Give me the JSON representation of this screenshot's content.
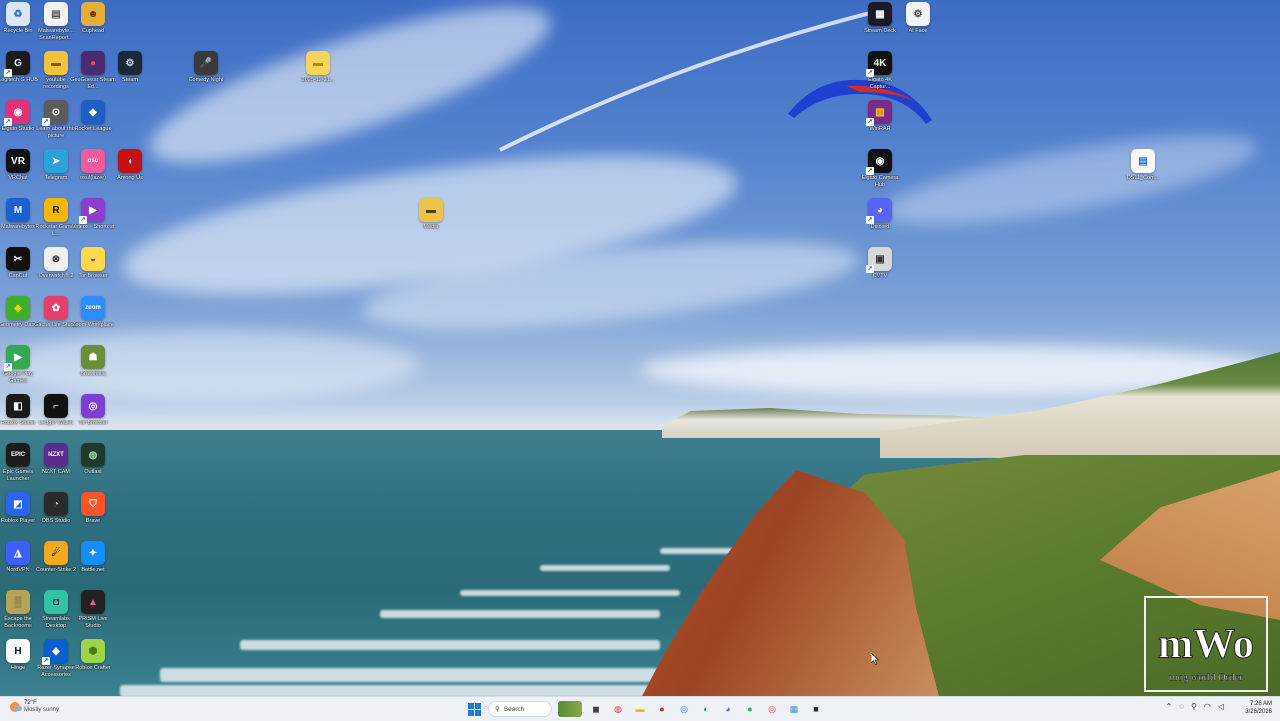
{
  "desktop": {
    "icons": [
      {
        "id": "recycle-bin",
        "label": "Recycle Bin",
        "color": "#d9e6f5",
        "glyph": "♻",
        "gcolor": "#2a6fd1"
      },
      {
        "id": "malwarebytes-doc",
        "label": "Malwarebyte... ScanReport...",
        "color": "#f2f2f2",
        "glyph": "▤",
        "gcolor": "#555"
      },
      {
        "id": "cuphead",
        "label": "Cuphead",
        "color": "#e0b03a",
        "glyph": "☻",
        "gcolor": "#6a2b12"
      },
      {
        "id": "logitech",
        "label": "Logitech G HUB",
        "color": "#1b1b1b",
        "glyph": "G",
        "gcolor": "#fff"
      },
      {
        "id": "youtube-recordings",
        "label": "youtube recordings",
        "color": "#f1c33b",
        "glyph": "▬",
        "gcolor": "#8a5b00"
      },
      {
        "id": "geoguessr",
        "label": "GeoGuessr Steam Ed...",
        "color": "#4a2b6e",
        "glyph": "●",
        "gcolor": "#f24a4a"
      },
      {
        "id": "steam",
        "label": "Steam",
        "color": "#1b2838",
        "glyph": "⚙",
        "gcolor": "#c6d4df"
      },
      {
        "id": "elgato-studio",
        "label": "Elgato Studio",
        "color": "#e0327a",
        "glyph": "◉",
        "gcolor": "#fff"
      },
      {
        "id": "learn-photo",
        "label": "Learn about this picture",
        "color": "#5c5c5c",
        "glyph": "⊙",
        "gcolor": "#fff"
      },
      {
        "id": "rocket-league",
        "label": "Rocket League",
        "color": "#1e5ec5",
        "glyph": "◆",
        "gcolor": "#fff"
      },
      {
        "id": "vrchat",
        "label": "VRChat",
        "color": "#111",
        "glyph": "VR",
        "gcolor": "#fff"
      },
      {
        "id": "telegram",
        "label": "Telegram",
        "color": "#2aa3dd",
        "glyph": "➤",
        "gcolor": "#fff"
      },
      {
        "id": "osu",
        "label": "osu!(lazer)",
        "color": "#f05ba0",
        "glyph": "osu",
        "gcolor": "#fff"
      },
      {
        "id": "among-us",
        "label": "Among Us",
        "color": "#c51111",
        "glyph": "◖",
        "gcolor": "#9ff"
      },
      {
        "id": "malwarebytes",
        "label": "Malwarebytes",
        "color": "#1b5fd1",
        "glyph": "M",
        "gcolor": "#fff"
      },
      {
        "id": "rockstar",
        "label": "Rockstar Games L...",
        "color": "#f5b800",
        "glyph": "R",
        "gcolor": "#111"
      },
      {
        "id": "videos-shortcut",
        "label": "Videos - Shortcut",
        "color": "#8a3fd1",
        "glyph": "▶",
        "gcolor": "#fff"
      },
      {
        "id": "capcut",
        "label": "CapCut",
        "color": "#111",
        "glyph": "✂",
        "gcolor": "#fff"
      },
      {
        "id": "overwatch",
        "label": "Overwatch® 2",
        "color": "#eee",
        "glyph": "⊗",
        "gcolor": "#333"
      },
      {
        "id": "tor-browser-1",
        "label": "Tor Browser",
        "color": "#ffd84d",
        "glyph": "◒",
        "gcolor": "#7d3fa0"
      },
      {
        "id": "geometry-dash",
        "label": "Geometry Dash",
        "color": "#3fae2a",
        "glyph": "◈",
        "gcolor": "#ffd000"
      },
      {
        "id": "gacha-life",
        "label": "Gacha Life Studio",
        "color": "#e5406a",
        "glyph": "✿",
        "gcolor": "#fff"
      },
      {
        "id": "zoom",
        "label": "Zoom Workplace",
        "color": "#2d8cff",
        "glyph": "zoom",
        "gcolor": "#fff"
      },
      {
        "id": "google-play-games",
        "label": "Google Play Games",
        "color": "#34a853",
        "glyph": "▶",
        "gcolor": "#fff"
      },
      {
        "id": "brawlhalla",
        "label": "Brawlhalla",
        "color": "#6a8f3a",
        "glyph": "☗",
        "gcolor": "#fff"
      },
      {
        "id": "roblox-studio",
        "label": "Roblox Studio",
        "color": "#1a1a1a",
        "glyph": "◧",
        "gcolor": "#fff"
      },
      {
        "id": "ledger-wallet",
        "label": "Ledger Wallet",
        "color": "#111",
        "glyph": "⌐",
        "gcolor": "#fff"
      },
      {
        "id": "tor-browser-2",
        "label": "Tor Browser",
        "color": "#7d3fd1",
        "glyph": "◎",
        "gcolor": "#fff"
      },
      {
        "id": "epic-games",
        "label": "Epic Games Launcher",
        "color": "#1c1c1c",
        "glyph": "EPIC",
        "gcolor": "#fff"
      },
      {
        "id": "nzxt-cam",
        "label": "NZXT CAM",
        "color": "#5a2d8a",
        "glyph": "NZXT",
        "gcolor": "#fff"
      },
      {
        "id": "outlast",
        "label": "Outlast",
        "color": "#1e3a2a",
        "glyph": "◍",
        "gcolor": "#9fd49f"
      },
      {
        "id": "roblox-player",
        "label": "Roblox Player",
        "color": "#2a64f0",
        "glyph": "◩",
        "gcolor": "#fff"
      },
      {
        "id": "obs-studio",
        "label": "OBS Studio",
        "color": "#2b2b2b",
        "glyph": "◔",
        "gcolor": "#fff"
      },
      {
        "id": "brave",
        "label": "Brave",
        "color": "#fb542b",
        "glyph": "⛉",
        "gcolor": "#fff"
      },
      {
        "id": "nordvpn",
        "label": "NordVPN",
        "color": "#3e5fff",
        "glyph": "◮",
        "gcolor": "#fff"
      },
      {
        "id": "counter-strike",
        "label": "Counter-Strike 2",
        "color": "#f2a81f",
        "glyph": "☄",
        "gcolor": "#333"
      },
      {
        "id": "battle-net",
        "label": "Battle.net",
        "color": "#148eff",
        "glyph": "✦",
        "gcolor": "#fff"
      },
      {
        "id": "escape-backrooms",
        "label": "Escape the Backrooms",
        "color": "#b7a25a",
        "glyph": "▒",
        "gcolor": "#5a4a1a"
      },
      {
        "id": "streamlabs",
        "label": "Streamlabs Desktop",
        "color": "#31c3a2",
        "glyph": "◘",
        "gcolor": "#0b2a24"
      },
      {
        "id": "prism-live",
        "label": "PRISM Live Studio",
        "color": "#222",
        "glyph": "▲",
        "gcolor": "#ff4fa0"
      },
      {
        "id": "hinge",
        "label": "Hinge",
        "color": "#fff",
        "glyph": "H",
        "gcolor": "#111"
      },
      {
        "id": "nvidia-app",
        "label": "Razer Synapse Accessories",
        "color": "#0a5fcf",
        "glyph": "◆",
        "gcolor": "#fff"
      },
      {
        "id": "robot-game",
        "label": "Roblox Crafter",
        "color": "#9fd44a",
        "glyph": "⬢",
        "gcolor": "#4a7a10"
      },
      {
        "id": "comedy-night",
        "label": "Comedy Night",
        "color": "#3a3a3a",
        "glyph": "🎤",
        "gcolor": "#ddd"
      },
      {
        "id": "folder-2025",
        "label": "2025-12-21...",
        "color": "#f4d45a",
        "glyph": "▬",
        "gcolor": "#b58a00"
      },
      {
        "id": "media-folder",
        "label": "Media",
        "color": "#e8c44a",
        "glyph": "▬",
        "gcolor": "#5a3d00"
      },
      {
        "id": "stream-deck",
        "label": "Stream Deck",
        "color": "#1a1a2a",
        "glyph": "▦",
        "gcolor": "#fff"
      },
      {
        "id": "ai-face",
        "label": "AI Face",
        "color": "#f2f2f2",
        "glyph": "⚙",
        "gcolor": "#444"
      },
      {
        "id": "elgato-4k",
        "label": "Elgato 4K Captur...",
        "color": "#111",
        "glyph": "4K",
        "gcolor": "#fff"
      },
      {
        "id": "winrar",
        "label": "WinRAR",
        "color": "#7a2a8a",
        "glyph": "▥",
        "gcolor": "#ffd000"
      },
      {
        "id": "elgato-camera-hub",
        "label": "Elgato Camera Hub",
        "color": "#111",
        "glyph": "◉",
        "gcolor": "#fff"
      },
      {
        "id": "discord",
        "label": "Discord",
        "color": "#5865f2",
        "glyph": "◕",
        "gcolor": "#fff"
      },
      {
        "id": "cvtv",
        "label": "CVTV",
        "color": "#d8d8d8",
        "glyph": "▣",
        "gcolor": "#333"
      },
      {
        "id": "ds-file",
        "label": "DS11_Com...",
        "color": "#f7f7f7",
        "glyph": "▤",
        "gcolor": "#2a6fd1"
      }
    ]
  },
  "watermark": {
    "text_main": "mWo",
    "text_sub": "mog world Order"
  },
  "taskbar": {
    "weather_temp": "72°F",
    "weather_desc": "Mostly sunny",
    "search_placeholder": "Search",
    "apps": [
      {
        "id": "taskbar-start",
        "glyph": "start"
      },
      {
        "id": "taskbar-widgets",
        "glyph": "◼",
        "color": "#444"
      },
      {
        "id": "taskbar-chrome-1",
        "glyph": "◍",
        "color": "#e33"
      },
      {
        "id": "taskbar-file-explorer",
        "glyph": "▬",
        "color": "#f2b800"
      },
      {
        "id": "taskbar-pinned-1",
        "glyph": "●",
        "color": "#c33"
      },
      {
        "id": "taskbar-chrome-2",
        "glyph": "◎",
        "color": "#1a73e8"
      },
      {
        "id": "taskbar-pinned-2",
        "glyph": "◐",
        "color": "#2a9d3a"
      },
      {
        "id": "taskbar-discord",
        "glyph": "◕",
        "color": "#5865f2"
      },
      {
        "id": "taskbar-spotify",
        "glyph": "●",
        "color": "#1db954"
      },
      {
        "id": "taskbar-chrome-3",
        "glyph": "◎",
        "color": "#d33"
      },
      {
        "id": "taskbar-calculator",
        "glyph": "▦",
        "color": "#3a8fd1"
      },
      {
        "id": "taskbar-pinned-3",
        "glyph": "■",
        "color": "#222"
      }
    ],
    "time": "7:26 AM",
    "date": "3/26/2026"
  }
}
